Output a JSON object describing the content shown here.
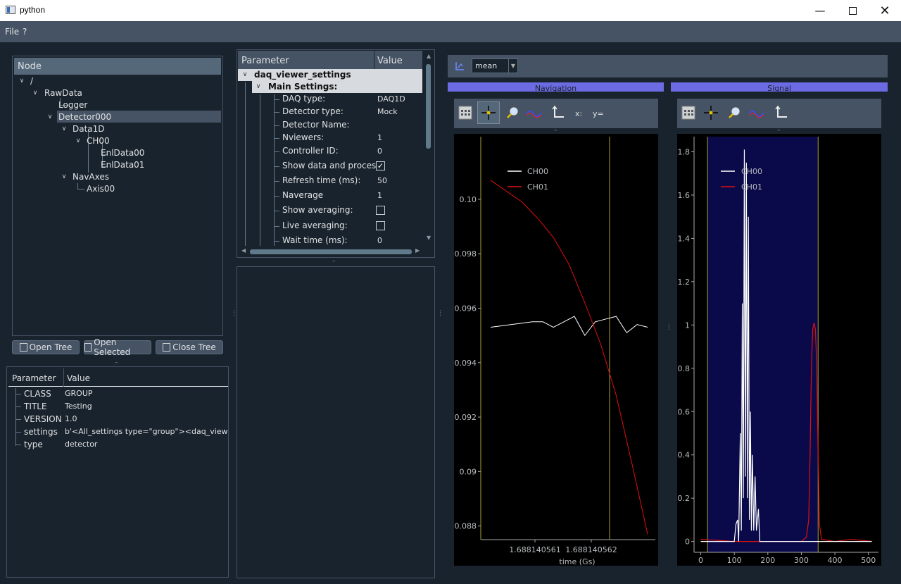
{
  "window": {
    "title": "python"
  },
  "menu": [
    "File",
    "?"
  ],
  "node_tree": {
    "header": "Node",
    "items": [
      "/",
      "RawData",
      "Logger",
      "Detector000",
      "Data1D",
      "CH00",
      "EnlData00",
      "EnlData01",
      "NavAxes",
      "Axis00"
    ]
  },
  "tree_buttons": {
    "open_tree": "Open Tree",
    "open_selected": "Open Selected",
    "close_tree": "Close Tree"
  },
  "attributes": {
    "headers": [
      "Parameter",
      "Value"
    ],
    "rows": [
      {
        "param": "CLASS",
        "value": "GROUP"
      },
      {
        "param": "TITLE",
        "value": "Testing"
      },
      {
        "param": "VERSION",
        "value": "1.0"
      },
      {
        "param": "settings",
        "value": "b'<All_settings type=\"group\"><daq_viewer_se"
      },
      {
        "param": "type",
        "value": "detector"
      }
    ]
  },
  "settings": {
    "headers": [
      "Parameter",
      "Value"
    ],
    "root": "daq_viewer_settings",
    "group": "Main Settings:",
    "rows": [
      {
        "label": "DAQ type:",
        "value": "DAQ1D"
      },
      {
        "label": "Detector type:",
        "value": "Mock"
      },
      {
        "label": "Detector Name:",
        "value": ""
      },
      {
        "label": "Nviewers:",
        "value": "1"
      },
      {
        "label": "Controller ID:",
        "value": "0"
      },
      {
        "label": "Show data and process:",
        "value": "checked"
      },
      {
        "label": "Refresh time (ms):",
        "value": "50"
      },
      {
        "label": "Naverage",
        "value": "1"
      },
      {
        "label": "Show averaging:",
        "value": "unchecked"
      },
      {
        "label": "Live averaging:",
        "value": "unchecked"
      },
      {
        "label": "Wait time (ms):",
        "value": "0"
      }
    ]
  },
  "viewer": {
    "mode": "mean",
    "nav_label": "Navigation",
    "signal_label": "Signal",
    "crosshair_x_label": "x:",
    "crosshair_y_label": "y="
  },
  "chart_data": [
    {
      "type": "line",
      "title": "Navigation",
      "xlabel": "time (Gs)",
      "x_ticks": [
        "1.688140561",
        "1.688140562"
      ],
      "y_ticks": [
        "0.088",
        "0.09",
        "0.092",
        "0.094",
        "0.096",
        "0.098",
        "0.10"
      ],
      "ylim": [
        0.0875,
        0.1023
      ],
      "x": [
        0,
        1,
        2,
        3,
        4,
        5,
        6,
        7,
        8,
        9,
        10,
        11,
        12,
        13,
        14,
        15,
        16,
        17,
        18,
        19,
        20
      ],
      "series": [
        {
          "name": "CH00",
          "color": "#ffffff",
          "values": [
            0.0953,
            0.09535,
            0.0954,
            0.09545,
            0.0955,
            0.0955,
            0.0953,
            0.0955,
            0.0957,
            0.095,
            0.0955,
            0.0956,
            0.0957,
            0.0951,
            0.0954,
            0.0953
          ]
        },
        {
          "name": "CH01",
          "color": "#e01010",
          "values": [
            0.1007,
            0.1003,
            0.0999,
            0.0993,
            0.0986,
            0.0976,
            0.0962,
            0.0947,
            0.0928,
            0.0903,
            0.0877
          ]
        }
      ],
      "legend": "top-left",
      "crosshair_lines": 2
    },
    {
      "type": "line",
      "title": "Signal",
      "x_ticks": [
        "0",
        "100",
        "200",
        "300",
        "400",
        "500"
      ],
      "y_ticks": [
        "0",
        "0.2",
        "0.4",
        "0.6",
        "0.8",
        "1",
        "1.2",
        "1.4",
        "1.6",
        "1.8"
      ],
      "xlim": [
        -20,
        530
      ],
      "ylim": [
        -0.05,
        1.87
      ],
      "series": [
        {
          "name": "CH00",
          "color": "#ffffff",
          "points": [
            [
              0,
              0
            ],
            [
              100,
              0
            ],
            [
              105,
              0.08
            ],
            [
              110,
              0.1
            ],
            [
              113,
              0
            ],
            [
              118,
              0.5
            ],
            [
              121,
              0.05
            ],
            [
              124,
              1.1
            ],
            [
              127,
              0.2
            ],
            [
              130,
              1.81
            ],
            [
              133,
              0.3
            ],
            [
              136,
              1.75
            ],
            [
              139,
              0.2
            ],
            [
              142,
              1.5
            ],
            [
              145,
              0.1
            ],
            [
              148,
              0.6
            ],
            [
              151,
              0.05
            ],
            [
              154,
              0.4
            ],
            [
              158,
              0.05
            ],
            [
              162,
              0.3
            ],
            [
              166,
              0.05
            ],
            [
              172,
              0.15
            ],
            [
              176,
              0
            ],
            [
              200,
              0
            ],
            [
              300,
              0
            ],
            [
              400,
              0
            ],
            [
              510,
              0
            ]
          ]
        },
        {
          "name": "CH01",
          "color": "#e01010",
          "points": [
            [
              0,
              0.01
            ],
            [
              100,
              0.0
            ],
            [
              200,
              0.0
            ],
            [
              300,
              0.0
            ],
            [
              315,
              0.02
            ],
            [
              322,
              0.1
            ],
            [
              326,
              0.4
            ],
            [
              330,
              0.8
            ],
            [
              334,
              0.98
            ],
            [
              338,
              1.01
            ],
            [
              342,
              0.98
            ],
            [
              346,
              0.8
            ],
            [
              350,
              0.4
            ],
            [
              354,
              0.08
            ],
            [
              360,
              0.01
            ],
            [
              400,
              0.0
            ],
            [
              450,
              0.01
            ],
            [
              510,
              0.0
            ]
          ]
        }
      ],
      "legend": "top-left",
      "roi_x": [
        20,
        350
      ]
    }
  ]
}
